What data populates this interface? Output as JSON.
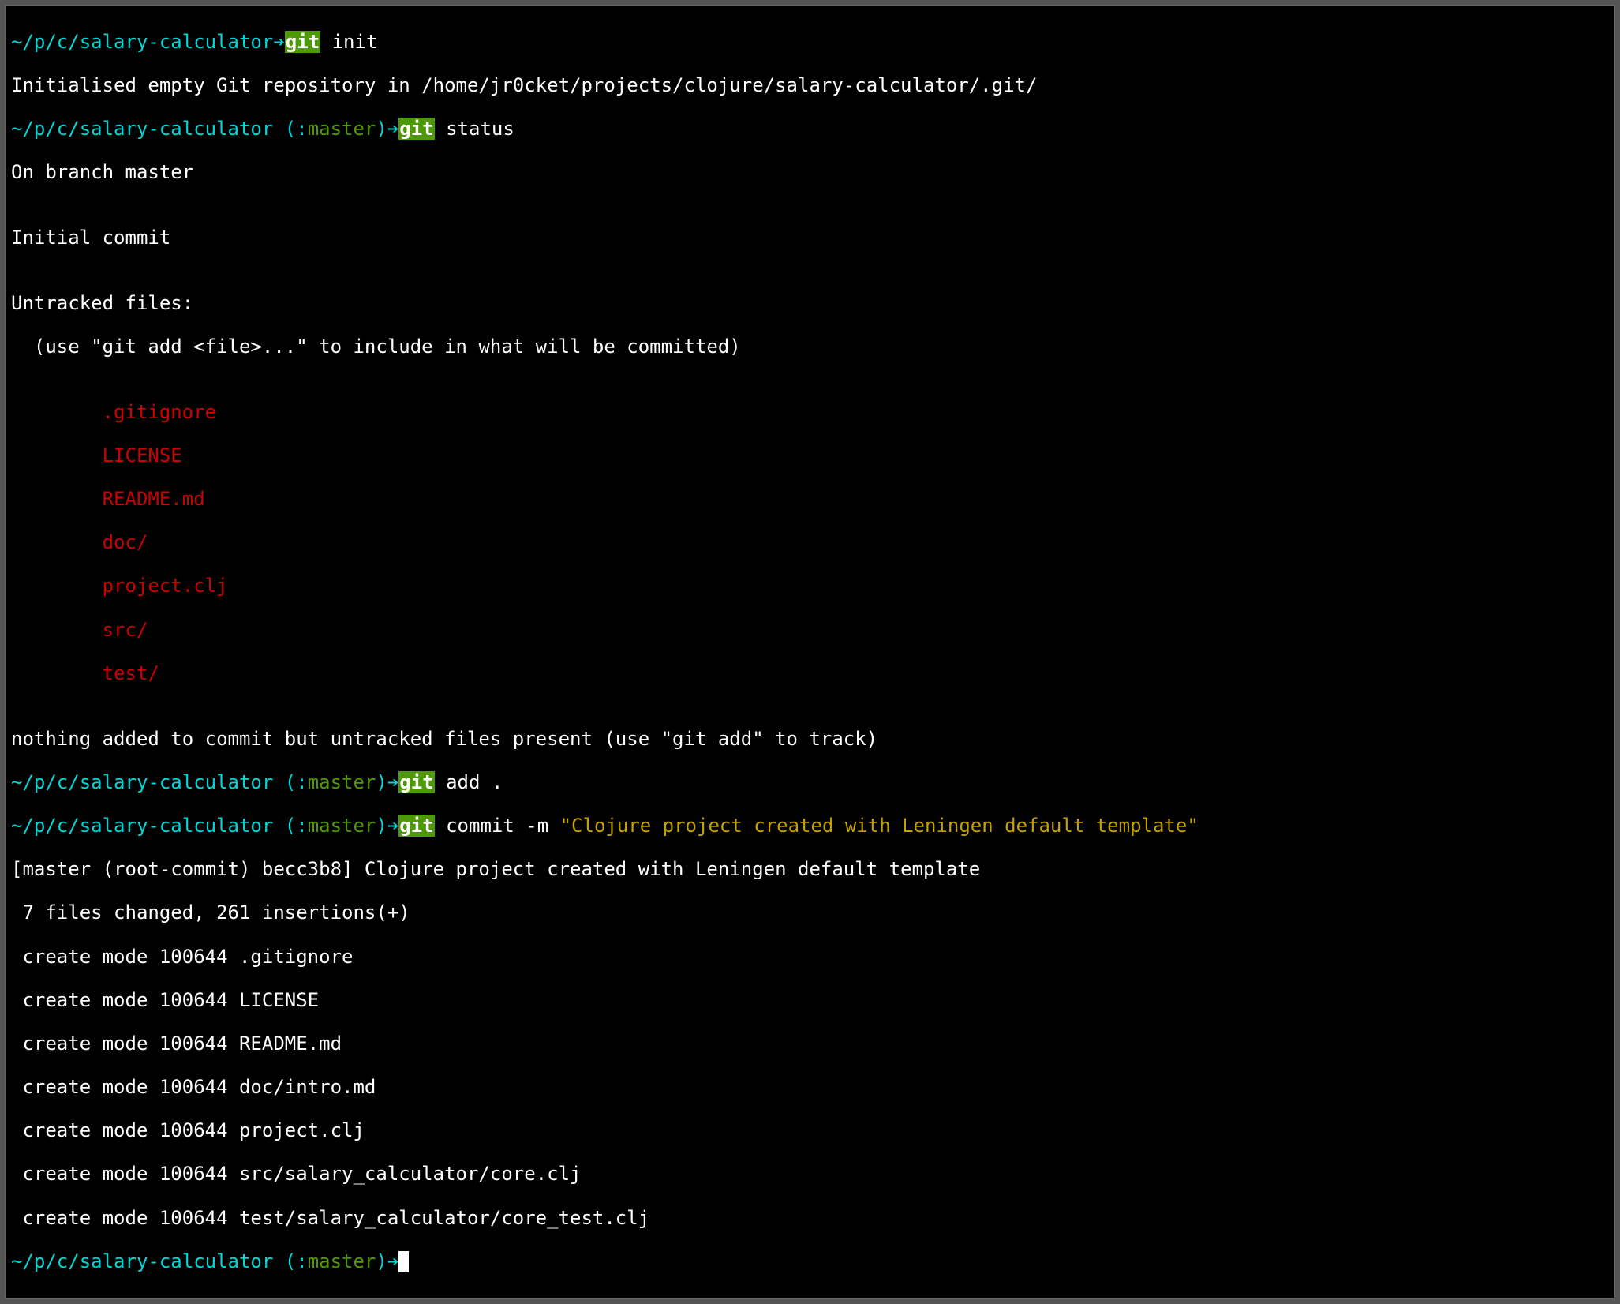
{
  "prompts": {
    "p1": {
      "path": "~/p/c/salary-calculator",
      "arrow": "➔",
      "cmd_hi": "git",
      "cmd_rest": " init"
    },
    "p2": {
      "path": "~/p/c/salary-calculator ",
      "branch_open": "(",
      "branch_colon": ":",
      "branch_name": "master",
      "branch_close": ")",
      "arrow": "➔",
      "cmd_hi": "git",
      "cmd_rest": " status"
    },
    "p3": {
      "path": "~/p/c/salary-calculator ",
      "branch_open": "(",
      "branch_colon": ":",
      "branch_name": "master",
      "branch_close": ")",
      "arrow": "➔",
      "cmd_hi": "git",
      "cmd_rest": " add ."
    },
    "p4": {
      "path": "~/p/c/salary-calculator ",
      "branch_open": "(",
      "branch_colon": ":",
      "branch_name": "master",
      "branch_close": ")",
      "arrow": "➔",
      "cmd_hi": "git",
      "cmd_rest_a": " commit -m ",
      "cmd_quote": "\"Clojure project created with Leningen default template\""
    },
    "p5": {
      "path": "~/p/c/salary-calculator ",
      "branch_open": "(",
      "branch_colon": ":",
      "branch_name": "master",
      "branch_close": ")",
      "arrow": "➔"
    }
  },
  "output": {
    "init_msg": "Initialised empty Git repository in /home/jr0cket/projects/clojure/salary-calculator/.git/",
    "status_branch": "On branch master",
    "blank": "",
    "status_initial": "Initial commit",
    "status_untracked_hdr": "Untracked files:",
    "status_untracked_hint": "  (use \"git add <file>...\" to include in what will be committed)",
    "untracked": [
      "        .gitignore",
      "        LICENSE",
      "        README.md",
      "        doc/",
      "        project.clj",
      "        src/",
      "        test/"
    ],
    "status_nothing": "nothing added to commit but untracked files present (use \"git add\" to track)",
    "commit_header": "[master (root-commit) becc3b8] Clojure project created with Leningen default template",
    "commit_stats": " 7 files changed, 261 insertions(+)",
    "created": [
      " create mode 100644 .gitignore",
      " create mode 100644 LICENSE",
      " create mode 100644 README.md",
      " create mode 100644 doc/intro.md",
      " create mode 100644 project.clj",
      " create mode 100644 src/salary_calculator/core.clj",
      " create mode 100644 test/salary_calculator/core_test.clj"
    ]
  }
}
